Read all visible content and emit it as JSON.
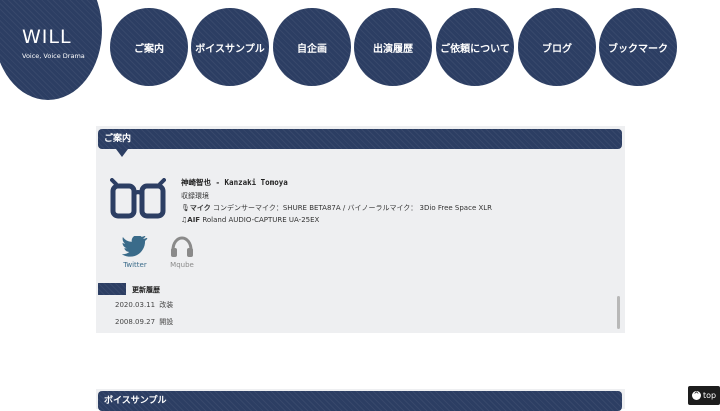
{
  "logo": {
    "title": "WILL",
    "subtitle": "Voice, Voice Drama"
  },
  "nav": [
    {
      "label": "ご案内"
    },
    {
      "label": "ボイスサンプル"
    },
    {
      "label": "自企画"
    },
    {
      "label": "出演履歴"
    },
    {
      "label": "ご依頼について"
    },
    {
      "label": "ブログ"
    },
    {
      "label": "ブックマーク"
    }
  ],
  "section1": {
    "title": "ご案内",
    "name": "神崎智也 - Kanzaki Tomoya",
    "env_label": "収録環境",
    "mic_label": "マイク",
    "mic_text": "コンデンサーマイク：SHURE BETA87A / バイノーラルマイク： 3Dio Free Space XLR",
    "aif_label": "AIF",
    "aif_text": "Roland AUDIO-CAPTURE UA-25EX",
    "social": [
      {
        "label": "Twitter",
        "icon": "twitter-bird-icon",
        "color": "#3a6b8a"
      },
      {
        "label": "Mqube",
        "icon": "headphones-icon",
        "color": "#8a8a8a"
      }
    ],
    "updates_title": "更新履歴",
    "updates": [
      {
        "date": "2020.03.11",
        "text": "改装"
      },
      {
        "date": "2008.09.27",
        "text": "開設"
      }
    ]
  },
  "section2": {
    "title": "ボイスサンプル"
  },
  "top_button": {
    "label": "top"
  },
  "colors": {
    "navy": "#2c3e63",
    "panel": "#eeeff1"
  }
}
